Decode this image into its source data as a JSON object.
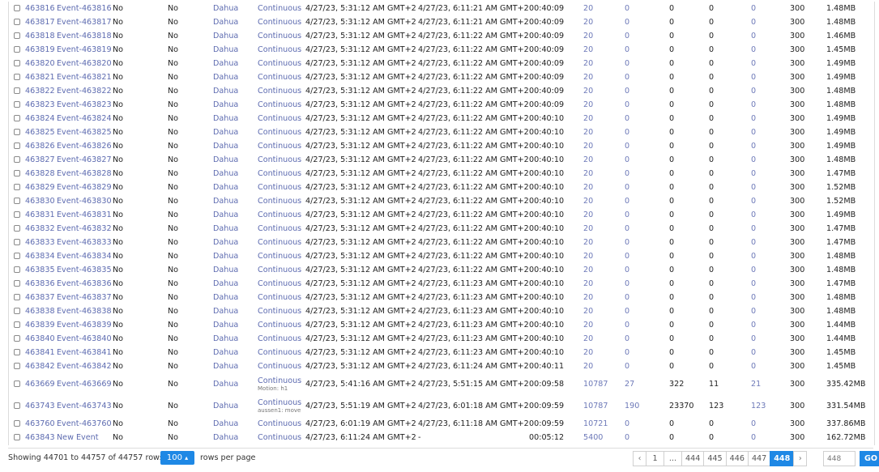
{
  "table": {
    "rows": [
      {
        "id": "463816",
        "name": "Event-463816",
        "c1": "No",
        "c2": "No",
        "vendor": "Dahua",
        "mode": "Continuous",
        "sub": "",
        "start": "4/27/23, 5:31:12 AM GMT+2",
        "end": "4/27/23, 6:11:21 AM GMT+2",
        "duration": "00:40:09",
        "frames": "20",
        "n1": "0",
        "n2": "0",
        "n3": "0",
        "n4": "0",
        "q": "300",
        "size": "1.48MB"
      },
      {
        "id": "463817",
        "name": "Event-463817",
        "c1": "No",
        "c2": "No",
        "vendor": "Dahua",
        "mode": "Continuous",
        "sub": "",
        "start": "4/27/23, 5:31:12 AM GMT+2",
        "end": "4/27/23, 6:11:21 AM GMT+2",
        "duration": "00:40:09",
        "frames": "20",
        "n1": "0",
        "n2": "0",
        "n3": "0",
        "n4": "0",
        "q": "300",
        "size": "1.48MB"
      },
      {
        "id": "463818",
        "name": "Event-463818",
        "c1": "No",
        "c2": "No",
        "vendor": "Dahua",
        "mode": "Continuous",
        "sub": "",
        "start": "4/27/23, 5:31:12 AM GMT+2",
        "end": "4/27/23, 6:11:22 AM GMT+2",
        "duration": "00:40:09",
        "frames": "20",
        "n1": "0",
        "n2": "0",
        "n3": "0",
        "n4": "0",
        "q": "300",
        "size": "1.46MB"
      },
      {
        "id": "463819",
        "name": "Event-463819",
        "c1": "No",
        "c2": "No",
        "vendor": "Dahua",
        "mode": "Continuous",
        "sub": "",
        "start": "4/27/23, 5:31:12 AM GMT+2",
        "end": "4/27/23, 6:11:22 AM GMT+2",
        "duration": "00:40:09",
        "frames": "20",
        "n1": "0",
        "n2": "0",
        "n3": "0",
        "n4": "0",
        "q": "300",
        "size": "1.45MB"
      },
      {
        "id": "463820",
        "name": "Event-463820",
        "c1": "No",
        "c2": "No",
        "vendor": "Dahua",
        "mode": "Continuous",
        "sub": "",
        "start": "4/27/23, 5:31:12 AM GMT+2",
        "end": "4/27/23, 6:11:22 AM GMT+2",
        "duration": "00:40:09",
        "frames": "20",
        "n1": "0",
        "n2": "0",
        "n3": "0",
        "n4": "0",
        "q": "300",
        "size": "1.49MB"
      },
      {
        "id": "463821",
        "name": "Event-463821",
        "c1": "No",
        "c2": "No",
        "vendor": "Dahua",
        "mode": "Continuous",
        "sub": "",
        "start": "4/27/23, 5:31:12 AM GMT+2",
        "end": "4/27/23, 6:11:22 AM GMT+2",
        "duration": "00:40:09",
        "frames": "20",
        "n1": "0",
        "n2": "0",
        "n3": "0",
        "n4": "0",
        "q": "300",
        "size": "1.49MB"
      },
      {
        "id": "463822",
        "name": "Event-463822",
        "c1": "No",
        "c2": "No",
        "vendor": "Dahua",
        "mode": "Continuous",
        "sub": "",
        "start": "4/27/23, 5:31:12 AM GMT+2",
        "end": "4/27/23, 6:11:22 AM GMT+2",
        "duration": "00:40:09",
        "frames": "20",
        "n1": "0",
        "n2": "0",
        "n3": "0",
        "n4": "0",
        "q": "300",
        "size": "1.48MB"
      },
      {
        "id": "463823",
        "name": "Event-463823",
        "c1": "No",
        "c2": "No",
        "vendor": "Dahua",
        "mode": "Continuous",
        "sub": "",
        "start": "4/27/23, 5:31:12 AM GMT+2",
        "end": "4/27/23, 6:11:22 AM GMT+2",
        "duration": "00:40:09",
        "frames": "20",
        "n1": "0",
        "n2": "0",
        "n3": "0",
        "n4": "0",
        "q": "300",
        "size": "1.48MB"
      },
      {
        "id": "463824",
        "name": "Event-463824",
        "c1": "No",
        "c2": "No",
        "vendor": "Dahua",
        "mode": "Continuous",
        "sub": "",
        "start": "4/27/23, 5:31:12 AM GMT+2",
        "end": "4/27/23, 6:11:22 AM GMT+2",
        "duration": "00:40:10",
        "frames": "20",
        "n1": "0",
        "n2": "0",
        "n3": "0",
        "n4": "0",
        "q": "300",
        "size": "1.49MB"
      },
      {
        "id": "463825",
        "name": "Event-463825",
        "c1": "No",
        "c2": "No",
        "vendor": "Dahua",
        "mode": "Continuous",
        "sub": "",
        "start": "4/27/23, 5:31:12 AM GMT+2",
        "end": "4/27/23, 6:11:22 AM GMT+2",
        "duration": "00:40:10",
        "frames": "20",
        "n1": "0",
        "n2": "0",
        "n3": "0",
        "n4": "0",
        "q": "300",
        "size": "1.49MB"
      },
      {
        "id": "463826",
        "name": "Event-463826",
        "c1": "No",
        "c2": "No",
        "vendor": "Dahua",
        "mode": "Continuous",
        "sub": "",
        "start": "4/27/23, 5:31:12 AM GMT+2",
        "end": "4/27/23, 6:11:22 AM GMT+2",
        "duration": "00:40:10",
        "frames": "20",
        "n1": "0",
        "n2": "0",
        "n3": "0",
        "n4": "0",
        "q": "300",
        "size": "1.49MB"
      },
      {
        "id": "463827",
        "name": "Event-463827",
        "c1": "No",
        "c2": "No",
        "vendor": "Dahua",
        "mode": "Continuous",
        "sub": "",
        "start": "4/27/23, 5:31:12 AM GMT+2",
        "end": "4/27/23, 6:11:22 AM GMT+2",
        "duration": "00:40:10",
        "frames": "20",
        "n1": "0",
        "n2": "0",
        "n3": "0",
        "n4": "0",
        "q": "300",
        "size": "1.48MB"
      },
      {
        "id": "463828",
        "name": "Event-463828",
        "c1": "No",
        "c2": "No",
        "vendor": "Dahua",
        "mode": "Continuous",
        "sub": "",
        "start": "4/27/23, 5:31:12 AM GMT+2",
        "end": "4/27/23, 6:11:22 AM GMT+2",
        "duration": "00:40:10",
        "frames": "20",
        "n1": "0",
        "n2": "0",
        "n3": "0",
        "n4": "0",
        "q": "300",
        "size": "1.47MB"
      },
      {
        "id": "463829",
        "name": "Event-463829",
        "c1": "No",
        "c2": "No",
        "vendor": "Dahua",
        "mode": "Continuous",
        "sub": "",
        "start": "4/27/23, 5:31:12 AM GMT+2",
        "end": "4/27/23, 6:11:22 AM GMT+2",
        "duration": "00:40:10",
        "frames": "20",
        "n1": "0",
        "n2": "0",
        "n3": "0",
        "n4": "0",
        "q": "300",
        "size": "1.52MB"
      },
      {
        "id": "463830",
        "name": "Event-463830",
        "c1": "No",
        "c2": "No",
        "vendor": "Dahua",
        "mode": "Continuous",
        "sub": "",
        "start": "4/27/23, 5:31:12 AM GMT+2",
        "end": "4/27/23, 6:11:22 AM GMT+2",
        "duration": "00:40:10",
        "frames": "20",
        "n1": "0",
        "n2": "0",
        "n3": "0",
        "n4": "0",
        "q": "300",
        "size": "1.52MB"
      },
      {
        "id": "463831",
        "name": "Event-463831",
        "c1": "No",
        "c2": "No",
        "vendor": "Dahua",
        "mode": "Continuous",
        "sub": "",
        "start": "4/27/23, 5:31:12 AM GMT+2",
        "end": "4/27/23, 6:11:22 AM GMT+2",
        "duration": "00:40:10",
        "frames": "20",
        "n1": "0",
        "n2": "0",
        "n3": "0",
        "n4": "0",
        "q": "300",
        "size": "1.49MB"
      },
      {
        "id": "463832",
        "name": "Event-463832",
        "c1": "No",
        "c2": "No",
        "vendor": "Dahua",
        "mode": "Continuous",
        "sub": "",
        "start": "4/27/23, 5:31:12 AM GMT+2",
        "end": "4/27/23, 6:11:22 AM GMT+2",
        "duration": "00:40:10",
        "frames": "20",
        "n1": "0",
        "n2": "0",
        "n3": "0",
        "n4": "0",
        "q": "300",
        "size": "1.47MB"
      },
      {
        "id": "463833",
        "name": "Event-463833",
        "c1": "No",
        "c2": "No",
        "vendor": "Dahua",
        "mode": "Continuous",
        "sub": "",
        "start": "4/27/23, 5:31:12 AM GMT+2",
        "end": "4/27/23, 6:11:22 AM GMT+2",
        "duration": "00:40:10",
        "frames": "20",
        "n1": "0",
        "n2": "0",
        "n3": "0",
        "n4": "0",
        "q": "300",
        "size": "1.47MB"
      },
      {
        "id": "463834",
        "name": "Event-463834",
        "c1": "No",
        "c2": "No",
        "vendor": "Dahua",
        "mode": "Continuous",
        "sub": "",
        "start": "4/27/23, 5:31:12 AM GMT+2",
        "end": "4/27/23, 6:11:22 AM GMT+2",
        "duration": "00:40:10",
        "frames": "20",
        "n1": "0",
        "n2": "0",
        "n3": "0",
        "n4": "0",
        "q": "300",
        "size": "1.48MB"
      },
      {
        "id": "463835",
        "name": "Event-463835",
        "c1": "No",
        "c2": "No",
        "vendor": "Dahua",
        "mode": "Continuous",
        "sub": "",
        "start": "4/27/23, 5:31:12 AM GMT+2",
        "end": "4/27/23, 6:11:22 AM GMT+2",
        "duration": "00:40:10",
        "frames": "20",
        "n1": "0",
        "n2": "0",
        "n3": "0",
        "n4": "0",
        "q": "300",
        "size": "1.48MB"
      },
      {
        "id": "463836",
        "name": "Event-463836",
        "c1": "No",
        "c2": "No",
        "vendor": "Dahua",
        "mode": "Continuous",
        "sub": "",
        "start": "4/27/23, 5:31:12 AM GMT+2",
        "end": "4/27/23, 6:11:23 AM GMT+2",
        "duration": "00:40:10",
        "frames": "20",
        "n1": "0",
        "n2": "0",
        "n3": "0",
        "n4": "0",
        "q": "300",
        "size": "1.47MB"
      },
      {
        "id": "463837",
        "name": "Event-463837",
        "c1": "No",
        "c2": "No",
        "vendor": "Dahua",
        "mode": "Continuous",
        "sub": "",
        "start": "4/27/23, 5:31:12 AM GMT+2",
        "end": "4/27/23, 6:11:23 AM GMT+2",
        "duration": "00:40:10",
        "frames": "20",
        "n1": "0",
        "n2": "0",
        "n3": "0",
        "n4": "0",
        "q": "300",
        "size": "1.48MB"
      },
      {
        "id": "463838",
        "name": "Event-463838",
        "c1": "No",
        "c2": "No",
        "vendor": "Dahua",
        "mode": "Continuous",
        "sub": "",
        "start": "4/27/23, 5:31:12 AM GMT+2",
        "end": "4/27/23, 6:11:23 AM GMT+2",
        "duration": "00:40:10",
        "frames": "20",
        "n1": "0",
        "n2": "0",
        "n3": "0",
        "n4": "0",
        "q": "300",
        "size": "1.48MB"
      },
      {
        "id": "463839",
        "name": "Event-463839",
        "c1": "No",
        "c2": "No",
        "vendor": "Dahua",
        "mode": "Continuous",
        "sub": "",
        "start": "4/27/23, 5:31:12 AM GMT+2",
        "end": "4/27/23, 6:11:23 AM GMT+2",
        "duration": "00:40:10",
        "frames": "20",
        "n1": "0",
        "n2": "0",
        "n3": "0",
        "n4": "0",
        "q": "300",
        "size": "1.44MB"
      },
      {
        "id": "463840",
        "name": "Event-463840",
        "c1": "No",
        "c2": "No",
        "vendor": "Dahua",
        "mode": "Continuous",
        "sub": "",
        "start": "4/27/23, 5:31:12 AM GMT+2",
        "end": "4/27/23, 6:11:23 AM GMT+2",
        "duration": "00:40:10",
        "frames": "20",
        "n1": "0",
        "n2": "0",
        "n3": "0",
        "n4": "0",
        "q": "300",
        "size": "1.44MB"
      },
      {
        "id": "463841",
        "name": "Event-463841",
        "c1": "No",
        "c2": "No",
        "vendor": "Dahua",
        "mode": "Continuous",
        "sub": "",
        "start": "4/27/23, 5:31:12 AM GMT+2",
        "end": "4/27/23, 6:11:23 AM GMT+2",
        "duration": "00:40:10",
        "frames": "20",
        "n1": "0",
        "n2": "0",
        "n3": "0",
        "n4": "0",
        "q": "300",
        "size": "1.45MB"
      },
      {
        "id": "463842",
        "name": "Event-463842",
        "c1": "No",
        "c2": "No",
        "vendor": "Dahua",
        "mode": "Continuous",
        "sub": "",
        "start": "4/27/23, 5:31:12 AM GMT+2",
        "end": "4/27/23, 6:11:24 AM GMT+2",
        "duration": "00:40:11",
        "frames": "20",
        "n1": "0",
        "n2": "0",
        "n3": "0",
        "n4": "0",
        "q": "300",
        "size": "1.45MB"
      },
      {
        "id": "463669",
        "name": "Event-463669",
        "c1": "No",
        "c2": "No",
        "vendor": "Dahua",
        "mode": "Continuous",
        "sub": "Motion: h1",
        "start": "4/27/23, 5:41:16 AM GMT+2",
        "end": "4/27/23, 5:51:15 AM GMT+2",
        "duration": "00:09:58",
        "frames": "10787",
        "n1": "27",
        "n2": "322",
        "n3": "11",
        "n4": "21",
        "q": "300",
        "size": "335.42MB"
      },
      {
        "id": "463743",
        "name": "Event-463743",
        "c1": "No",
        "c2": "No",
        "vendor": "Dahua",
        "mode": "Continuous",
        "sub": "aussen1: move",
        "start": "4/27/23, 5:51:19 AM GMT+2",
        "end": "4/27/23, 6:01:18 AM GMT+2",
        "duration": "00:09:59",
        "frames": "10787",
        "n1": "190",
        "n2": "23370",
        "n3": "123",
        "n4": "123",
        "q": "300",
        "size": "331.54MB"
      },
      {
        "id": "463760",
        "name": "Event-463760",
        "c1": "No",
        "c2": "No",
        "vendor": "Dahua",
        "mode": "Continuous",
        "sub": "",
        "start": "4/27/23, 6:01:19 AM GMT+2",
        "end": "4/27/23, 6:11:18 AM GMT+2",
        "duration": "00:09:59",
        "frames": "10721",
        "n1": "0",
        "n2": "0",
        "n3": "0",
        "n4": "0",
        "q": "300",
        "size": "337.86MB"
      },
      {
        "id": "463843",
        "name": "New Event",
        "c1": "No",
        "c2": "No",
        "vendor": "Dahua",
        "mode": "Continuous",
        "sub": "",
        "start": "4/27/23, 6:11:24 AM GMT+2",
        "end": "-",
        "duration": "00:05:12",
        "frames": "5400",
        "n1": "0",
        "n2": "0",
        "n3": "0",
        "n4": "0",
        "q": "300",
        "size": "162.72MB"
      }
    ]
  },
  "footer": {
    "rows_info": "Showing 44701 to 44757 of 44757 rows",
    "per_page_value": "100",
    "per_page_caret": "▴",
    "rows_per_page_label": "rows per page",
    "pages": [
      "‹",
      "1",
      "...",
      "444",
      "445",
      "446",
      "447",
      "448",
      "›"
    ],
    "active_page": "448",
    "goto_placeholder": "448",
    "go_label": "GO"
  },
  "colors": {
    "accent": "#1e88e5",
    "link": "#5d6bb0"
  }
}
